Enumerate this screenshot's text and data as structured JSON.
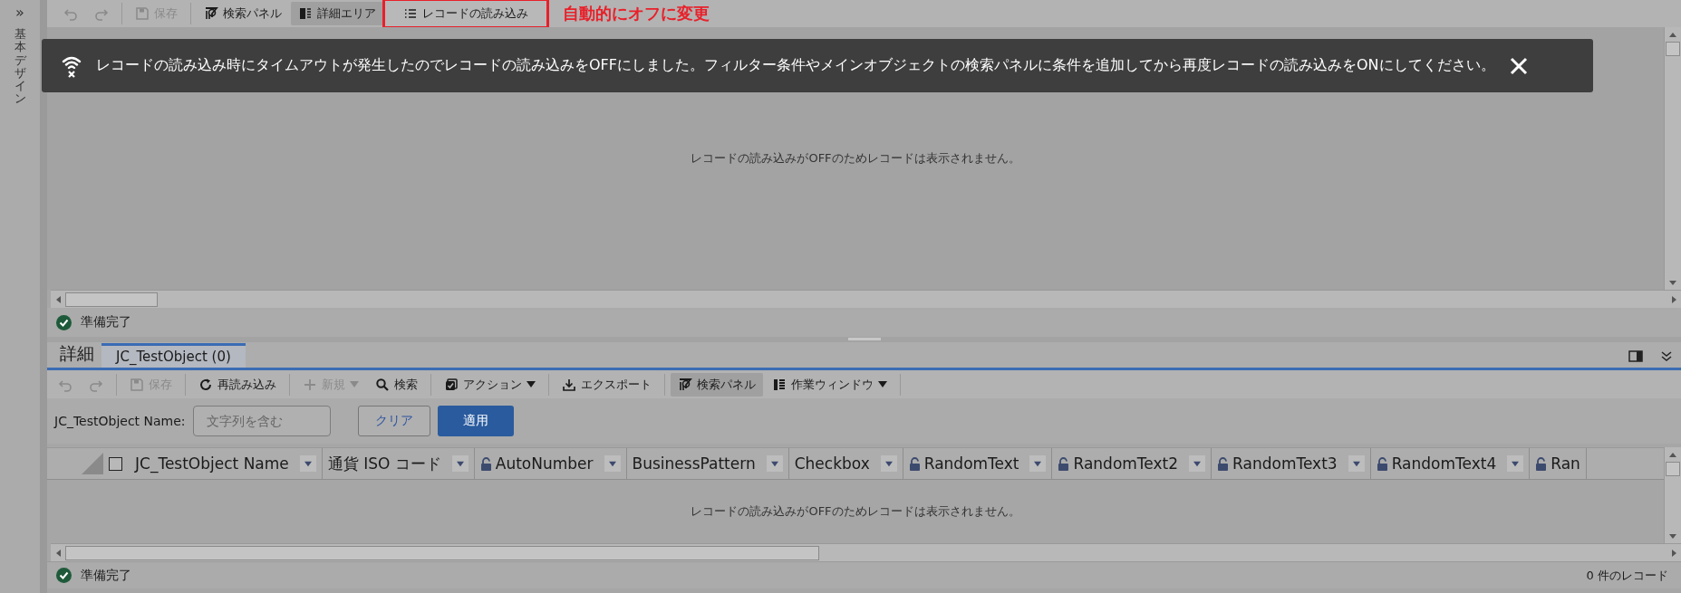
{
  "sidebar": {
    "expand_glyph": "»",
    "title": "基本デザイン"
  },
  "toolbar": {
    "items": [
      {
        "kind": "undo",
        "disabled": true,
        "pressed": false,
        "highlighted": false
      },
      {
        "kind": "redo",
        "disabled": true,
        "pressed": false,
        "highlighted": false
      },
      {
        "kind": "save",
        "label": "保存",
        "disabled": true,
        "pressed": false,
        "highlighted": false
      },
      {
        "kind": "searchpanel",
        "label": "検索パネル",
        "disabled": false,
        "pressed": false,
        "highlighted": false
      },
      {
        "kind": "detail",
        "label": "詳細エリア",
        "disabled": false,
        "pressed": true,
        "highlighted": false
      },
      {
        "kind": "list",
        "label": "レコードの読み込み",
        "disabled": false,
        "pressed": false,
        "highlighted": true
      }
    ]
  },
  "annotation": {
    "text": "自動的にオフに変更"
  },
  "notification": {
    "message": "レコードの読み込み時にタイムアウトが発生したのでレコードの読み込みをOFFにしました。フィルター条件やメインオブジェクトの検索パネルに条件を追加してから再度レコードの読み込みをONにしてください。"
  },
  "upper_grid": {
    "empty_message": "レコードの読み込みがOFFのためレコードは表示されません。"
  },
  "upper_status": {
    "text": "準備完了"
  },
  "detail": {
    "title": "詳細",
    "tabs": [
      {
        "label": "JC_TestObject  (0)",
        "selected": true
      }
    ],
    "toolbar": {
      "items": [
        {
          "kind": "undo",
          "disabled": true,
          "pressed": false,
          "dropdown": false
        },
        {
          "kind": "redo",
          "disabled": true,
          "pressed": false,
          "dropdown": false
        },
        {
          "kind": "save",
          "label": "保存",
          "disabled": true,
          "pressed": false,
          "dropdown": false
        },
        {
          "kind": "reload",
          "label": "再読み込み",
          "disabled": false,
          "pressed": false,
          "dropdown": false
        },
        {
          "kind": "new",
          "label": "新規",
          "disabled": true,
          "pressed": false,
          "dropdown": true
        },
        {
          "kind": "search",
          "label": "検索",
          "disabled": false,
          "pressed": false,
          "dropdown": false
        },
        {
          "kind": "action",
          "label": "アクション",
          "disabled": false,
          "pressed": false,
          "dropdown": true
        },
        {
          "kind": "export",
          "label": "エクスポート",
          "disabled": false,
          "pressed": false,
          "dropdown": false
        },
        {
          "kind": "searchpanel",
          "label": "検索パネル",
          "disabled": false,
          "pressed": true,
          "dropdown": false
        },
        {
          "kind": "window",
          "label": "作業ウィンドウ",
          "disabled": false,
          "pressed": false,
          "dropdown": true
        }
      ]
    },
    "filter": {
      "label": "JC_TestObject Name:",
      "placeholder": "文字列を含む",
      "clear_button": "クリア",
      "apply_button": "適用"
    },
    "table": {
      "select_all_checked": false,
      "columns": [
        {
          "label": "JC_TestObject Name",
          "locked": false,
          "dropdown": true
        },
        {
          "label": "通貨 ISO コード",
          "locked": false,
          "dropdown": true
        },
        {
          "label": "AutoNumber",
          "locked": true,
          "dropdown": true
        },
        {
          "label": "BusinessPattern",
          "locked": false,
          "dropdown": true
        },
        {
          "label": "Checkbox",
          "locked": false,
          "dropdown": true
        },
        {
          "label": "RandomText",
          "locked": true,
          "dropdown": true
        },
        {
          "label": "RandomText2",
          "locked": true,
          "dropdown": true
        },
        {
          "label": "RandomText3",
          "locked": true,
          "dropdown": true
        },
        {
          "label": "RandomText4",
          "locked": true,
          "dropdown": true
        },
        {
          "label": "Ran",
          "locked": true,
          "dropdown": false
        }
      ],
      "empty_message": "レコードの読み込みがOFFのためレコードは表示されません。"
    },
    "status": {
      "text": "準備完了",
      "record_count": "0 件のレコード"
    }
  }
}
